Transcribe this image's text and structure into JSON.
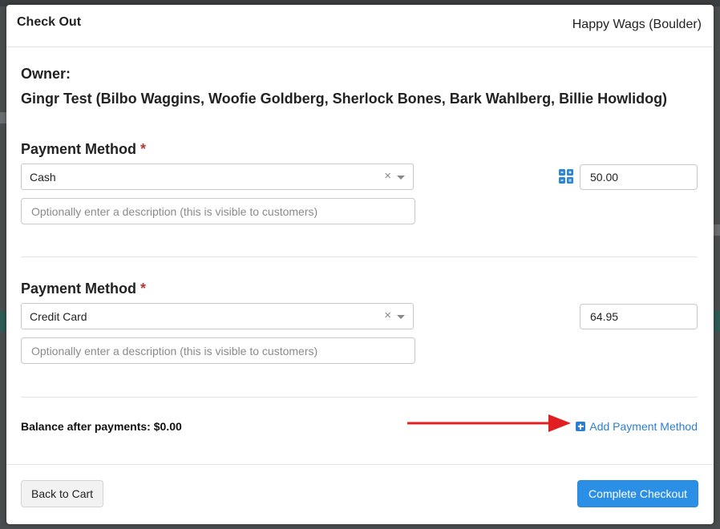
{
  "modal": {
    "title": "Check Out",
    "location": "Happy Wags (Boulder)"
  },
  "owner": {
    "label": "Owner:",
    "name": "Gingr Test (Bilbo Waggins, Woofie Goldberg, Sherlock Bones, Bark Wahlberg, Billie Howlidog)"
  },
  "payments": [
    {
      "label": "Payment Method",
      "required_mark": "*",
      "method": "Cash",
      "clear_glyph": "×",
      "description_placeholder": "Optionally enter a description (this is visible to customers)",
      "amount": "50.00",
      "has_calculator_icon": true
    },
    {
      "label": "Payment Method",
      "required_mark": "*",
      "method": "Credit Card",
      "clear_glyph": "×",
      "description_placeholder": "Optionally enter a description (this is visible to customers)",
      "amount": "64.95",
      "has_calculator_icon": false
    }
  ],
  "balance_text": "Balance after payments: $0.00",
  "add_payment_label": "Add Payment Method",
  "footer": {
    "back_label": "Back to Cart",
    "complete_label": "Complete Checkout"
  },
  "colors": {
    "accent": "#2c8fe6",
    "link": "#2a7fd4",
    "required": "#b43a3a",
    "annotation_arrow": "#e02020"
  },
  "icons": {
    "calculator": "grid-calculator-icon",
    "add": "plus-square-icon",
    "clear": "clear-x-icon",
    "dropdown": "chevron-down-icon"
  }
}
